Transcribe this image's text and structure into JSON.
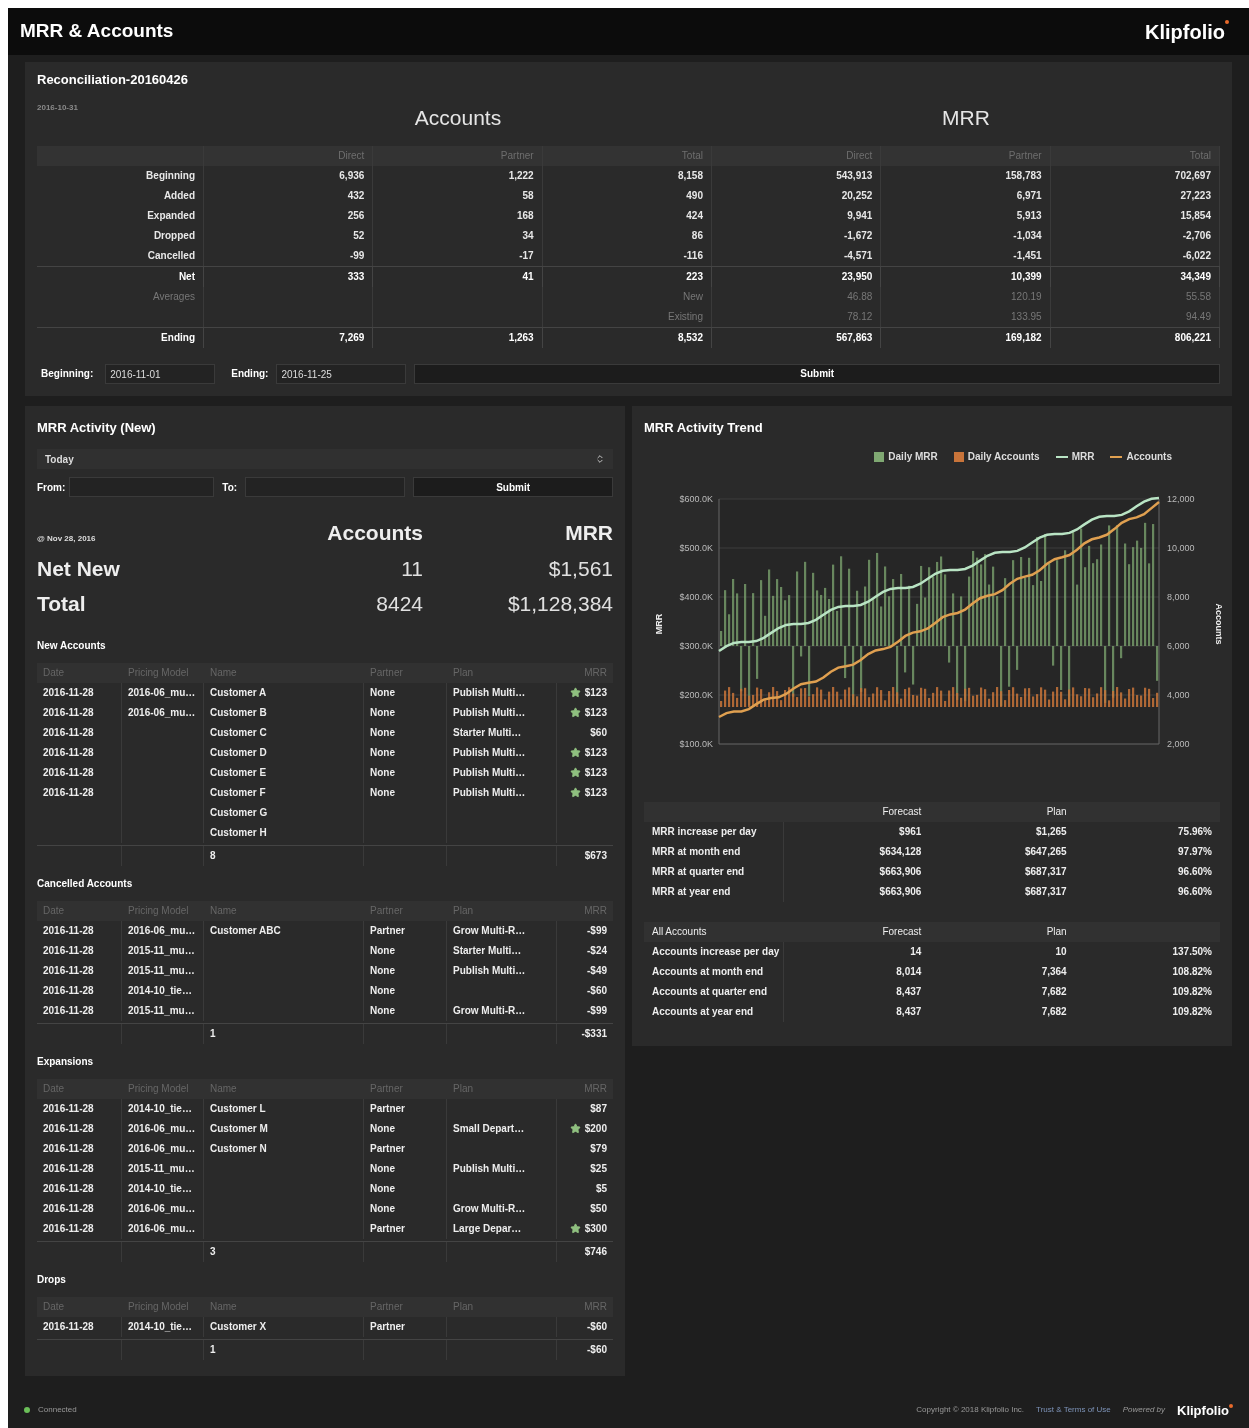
{
  "header": {
    "title": "MRR & Accounts",
    "logo": "Klipfolio"
  },
  "reconciliation": {
    "title": "Reconciliation-20160426",
    "date": "2016-10-31",
    "group_headers": [
      "Accounts",
      "MRR"
    ],
    "columns": [
      "Direct",
      "Partner",
      "Total",
      "Direct",
      "Partner",
      "Total"
    ],
    "rows": [
      {
        "kind": "normal",
        "label": "Beginning",
        "values": [
          "6,936",
          "1,222",
          "8,158",
          "543,913",
          "158,783",
          "702,697"
        ]
      },
      {
        "kind": "normal",
        "label": "Added",
        "values": [
          "432",
          "58",
          "490",
          "20,252",
          "6,971",
          "27,223"
        ]
      },
      {
        "kind": "normal",
        "label": "Expanded",
        "values": [
          "256",
          "168",
          "424",
          "9,941",
          "5,913",
          "15,854"
        ]
      },
      {
        "kind": "normal",
        "label": "Dropped",
        "values": [
          "52",
          "34",
          "86",
          "-1,672",
          "-1,034",
          "-2,706"
        ]
      },
      {
        "kind": "normal",
        "label": "Cancelled",
        "values": [
          "-99",
          "-17",
          "-116",
          "-4,571",
          "-1,451",
          "-6,022"
        ]
      },
      {
        "kind": "net",
        "label": "Net",
        "values": [
          "333",
          "41",
          "223",
          "23,950",
          "10,399",
          "34,349"
        ]
      },
      {
        "kind": "avg",
        "label": "Averages",
        "sub": "New",
        "values": [
          "46.88",
          "120.19",
          "55.58"
        ]
      },
      {
        "kind": "avg",
        "sub": "Existing",
        "values": [
          "78.12",
          "133.95",
          "94.49"
        ]
      },
      {
        "kind": "ending",
        "label": "Ending",
        "values": [
          "7,269",
          "1,263",
          "8,532",
          "567,863",
          "169,182",
          "806,221"
        ]
      }
    ],
    "form": {
      "beginning_label": "Beginning:",
      "beginning_value": "2016-11-01",
      "ending_label": "Ending:",
      "ending_value": "2016-11-25",
      "submit": "Submit"
    }
  },
  "activity": {
    "title": "MRR Activity (New)",
    "period": "Today",
    "from_label": "From:",
    "to_label": "To:",
    "submit": "Submit",
    "as_of": "@ Nov 28, 2016",
    "stat_headers": [
      "Accounts",
      "MRR"
    ],
    "stats": [
      {
        "label": "Net New",
        "accounts": "11",
        "mrr": "$1,561"
      },
      {
        "label": "Total",
        "accounts": "8424",
        "mrr": "$1,128,384"
      }
    ],
    "sections": [
      {
        "title": "New Accounts",
        "columns": [
          "Date",
          "Pricing Model",
          "Name",
          "Partner",
          "Plan",
          "MRR"
        ],
        "rows": [
          {
            "date": "2016-11-28",
            "model": "2016-06_mu…",
            "name": "Customer A",
            "partner": "None",
            "plan": "Publish Multi…",
            "mrr": "$123",
            "starred": true
          },
          {
            "date": "2016-11-28",
            "model": "2016-06_mu…",
            "name": "Customer B",
            "partner": "None",
            "plan": "Publish Multi…",
            "mrr": "$123",
            "starred": true
          },
          {
            "date": "2016-11-28",
            "name": "Customer C",
            "partner": "None",
            "plan": "Starter Multi…",
            "mrr": "$60",
            "starred": false
          },
          {
            "date": "2016-11-28",
            "name": "Customer D",
            "partner": "None",
            "plan": "Publish Multi…",
            "mrr": "$123",
            "starred": true
          },
          {
            "date": "2016-11-28",
            "name": "Customer E",
            "partner": "None",
            "plan": "Publish Multi…",
            "mrr": "$123",
            "starred": true
          },
          {
            "date": "2016-11-28",
            "name": "Customer F",
            "partner": "None",
            "plan": "Publish Multi…",
            "mrr": "$123",
            "starred": true
          },
          {
            "name": "Customer G",
            "starred": false
          },
          {
            "name": "Customer H",
            "starred": false
          }
        ],
        "count": "8",
        "total": "$673"
      },
      {
        "title": "Cancelled Accounts",
        "columns": [
          "Date",
          "Pricing Model",
          "Name",
          "Partner",
          "Plan",
          "MRR"
        ],
        "rows": [
          {
            "date": "2016-11-28",
            "model": "2016-06_mu…",
            "name": "Customer ABC",
            "partner": "Partner",
            "plan": "Grow Multi-R…",
            "mrr": "-$99",
            "starred": false
          },
          {
            "date": "2016-11-28",
            "model": "2015-11_mu…",
            "partner": "None",
            "plan": "Starter Multi…",
            "mrr": "-$24",
            "starred": false
          },
          {
            "date": "2016-11-28",
            "model": "2015-11_mu…",
            "partner": "None",
            "plan": "Publish Multi…",
            "mrr": "-$49",
            "starred": false
          },
          {
            "date": "2016-11-28",
            "model": "2014-10_tie…",
            "partner": "None",
            "mrr": "-$60",
            "starred": false
          },
          {
            "date": "2016-11-28",
            "model": "2015-11_mu…",
            "partner": "None",
            "plan": "Grow Multi-R…",
            "mrr": "-$99",
            "starred": false
          }
        ],
        "count": "1",
        "total": "-$331"
      },
      {
        "title": "Expansions",
        "columns": [
          "Date",
          "Pricing Model",
          "Name",
          "Partner",
          "Plan",
          "MRR"
        ],
        "rows": [
          {
            "date": "2016-11-28",
            "model": "2014-10_tie…",
            "name": "Customer L",
            "partner": "Partner",
            "mrr": "$87",
            "starred": false
          },
          {
            "date": "2016-11-28",
            "model": "2016-06_mu…",
            "name": "Customer M",
            "partner": "None",
            "plan": "Small Depart…",
            "mrr": "$200",
            "starred": true
          },
          {
            "date": "2016-11-28",
            "model": "2016-06_mu…",
            "name": "Customer N",
            "partner": "Partner",
            "mrr": "$79",
            "starred": false
          },
          {
            "date": "2016-11-28",
            "model": "2015-11_mu…",
            "partner": "None",
            "plan": "Publish Multi…",
            "mrr": "$25",
            "starred": false
          },
          {
            "date": "2016-11-28",
            "model": "2014-10_tie…",
            "partner": "None",
            "mrr": "$5",
            "starred": false
          },
          {
            "date": "2016-11-28",
            "model": "2016-06_mu…",
            "partner": "None",
            "plan": "Grow Multi-R…",
            "mrr": "$50",
            "starred": false
          },
          {
            "date": "2016-11-28",
            "model": "2016-06_mu…",
            "partner": "Partner",
            "plan": "Large Depar…",
            "mrr": "$300",
            "starred": true
          }
        ],
        "count": "3",
        "total": "$746"
      },
      {
        "title": "Drops",
        "columns": [
          "Date",
          "Pricing Model",
          "Name",
          "Partner",
          "Plan",
          "MRR"
        ],
        "rows": [
          {
            "date": "2016-11-28",
            "model": "2014-10_tie…",
            "name": "Customer X",
            "partner": "Partner",
            "mrr": "-$60",
            "starred": false
          }
        ],
        "count": "1",
        "total": "-$60"
      }
    ]
  },
  "trend": {
    "title": "MRR Activity Trend",
    "legend": [
      {
        "label": "Daily MRR",
        "kind": "bar",
        "color": "#7fa872"
      },
      {
        "label": "Daily Accounts",
        "kind": "bar",
        "color": "#c8743a"
      },
      {
        "label": "MRR",
        "kind": "line",
        "color": "#b9e4c4"
      },
      {
        "label": "Accounts",
        "kind": "line",
        "color": "#e0a050"
      }
    ],
    "yticks": [
      "$600.0K",
      "$500.0K",
      "$400.0K",
      "$300.0K",
      "$200.0K",
      "$100.0K"
    ],
    "y2ticks": [
      "12,000",
      "10,000",
      "8,000",
      "6,000",
      "4,000",
      "2,000"
    ],
    "ylabel": "MRR",
    "y2label": "Accounts"
  },
  "forecast_tables": [
    {
      "columns": [
        "Forecast",
        "Plan"
      ],
      "rows": [
        {
          "label": "MRR increase per day",
          "forecast": "$961",
          "plan": "$1,265",
          "ratio": "75.96%"
        },
        {
          "label": "MRR at month end",
          "forecast": "$634,128",
          "plan": "$647,265",
          "ratio": "97.97%"
        },
        {
          "label": "MRR at quarter end",
          "forecast": "$663,906",
          "plan": "$687,317",
          "ratio": "96.60%"
        },
        {
          "label": "MRR at year end",
          "forecast": "$663,906",
          "plan": "$687,317",
          "ratio": "96.60%"
        }
      ]
    },
    {
      "corner": "All Accounts",
      "columns": [
        "Forecast",
        "Plan"
      ],
      "rows": [
        {
          "label": "Accounts increase per day",
          "forecast": "14",
          "plan": "10",
          "ratio": "137.50%"
        },
        {
          "label": "Accounts at month end",
          "forecast": "8,014",
          "plan": "7,364",
          "ratio": "108.82%"
        },
        {
          "label": "Accounts at quarter end",
          "forecast": "8,437",
          "plan": "7,682",
          "ratio": "109.82%"
        },
        {
          "label": "Accounts at year end",
          "forecast": "8,437",
          "plan": "7,682",
          "ratio": "109.82%"
        }
      ]
    }
  ],
  "footer": {
    "status": "Connected",
    "connected": true,
    "copyright": "Copyright © 2018 Klipfolio Inc.",
    "link": "Trust & Terms of Use",
    "powered_by": "Powered by",
    "logo": "Klipfolio"
  }
}
